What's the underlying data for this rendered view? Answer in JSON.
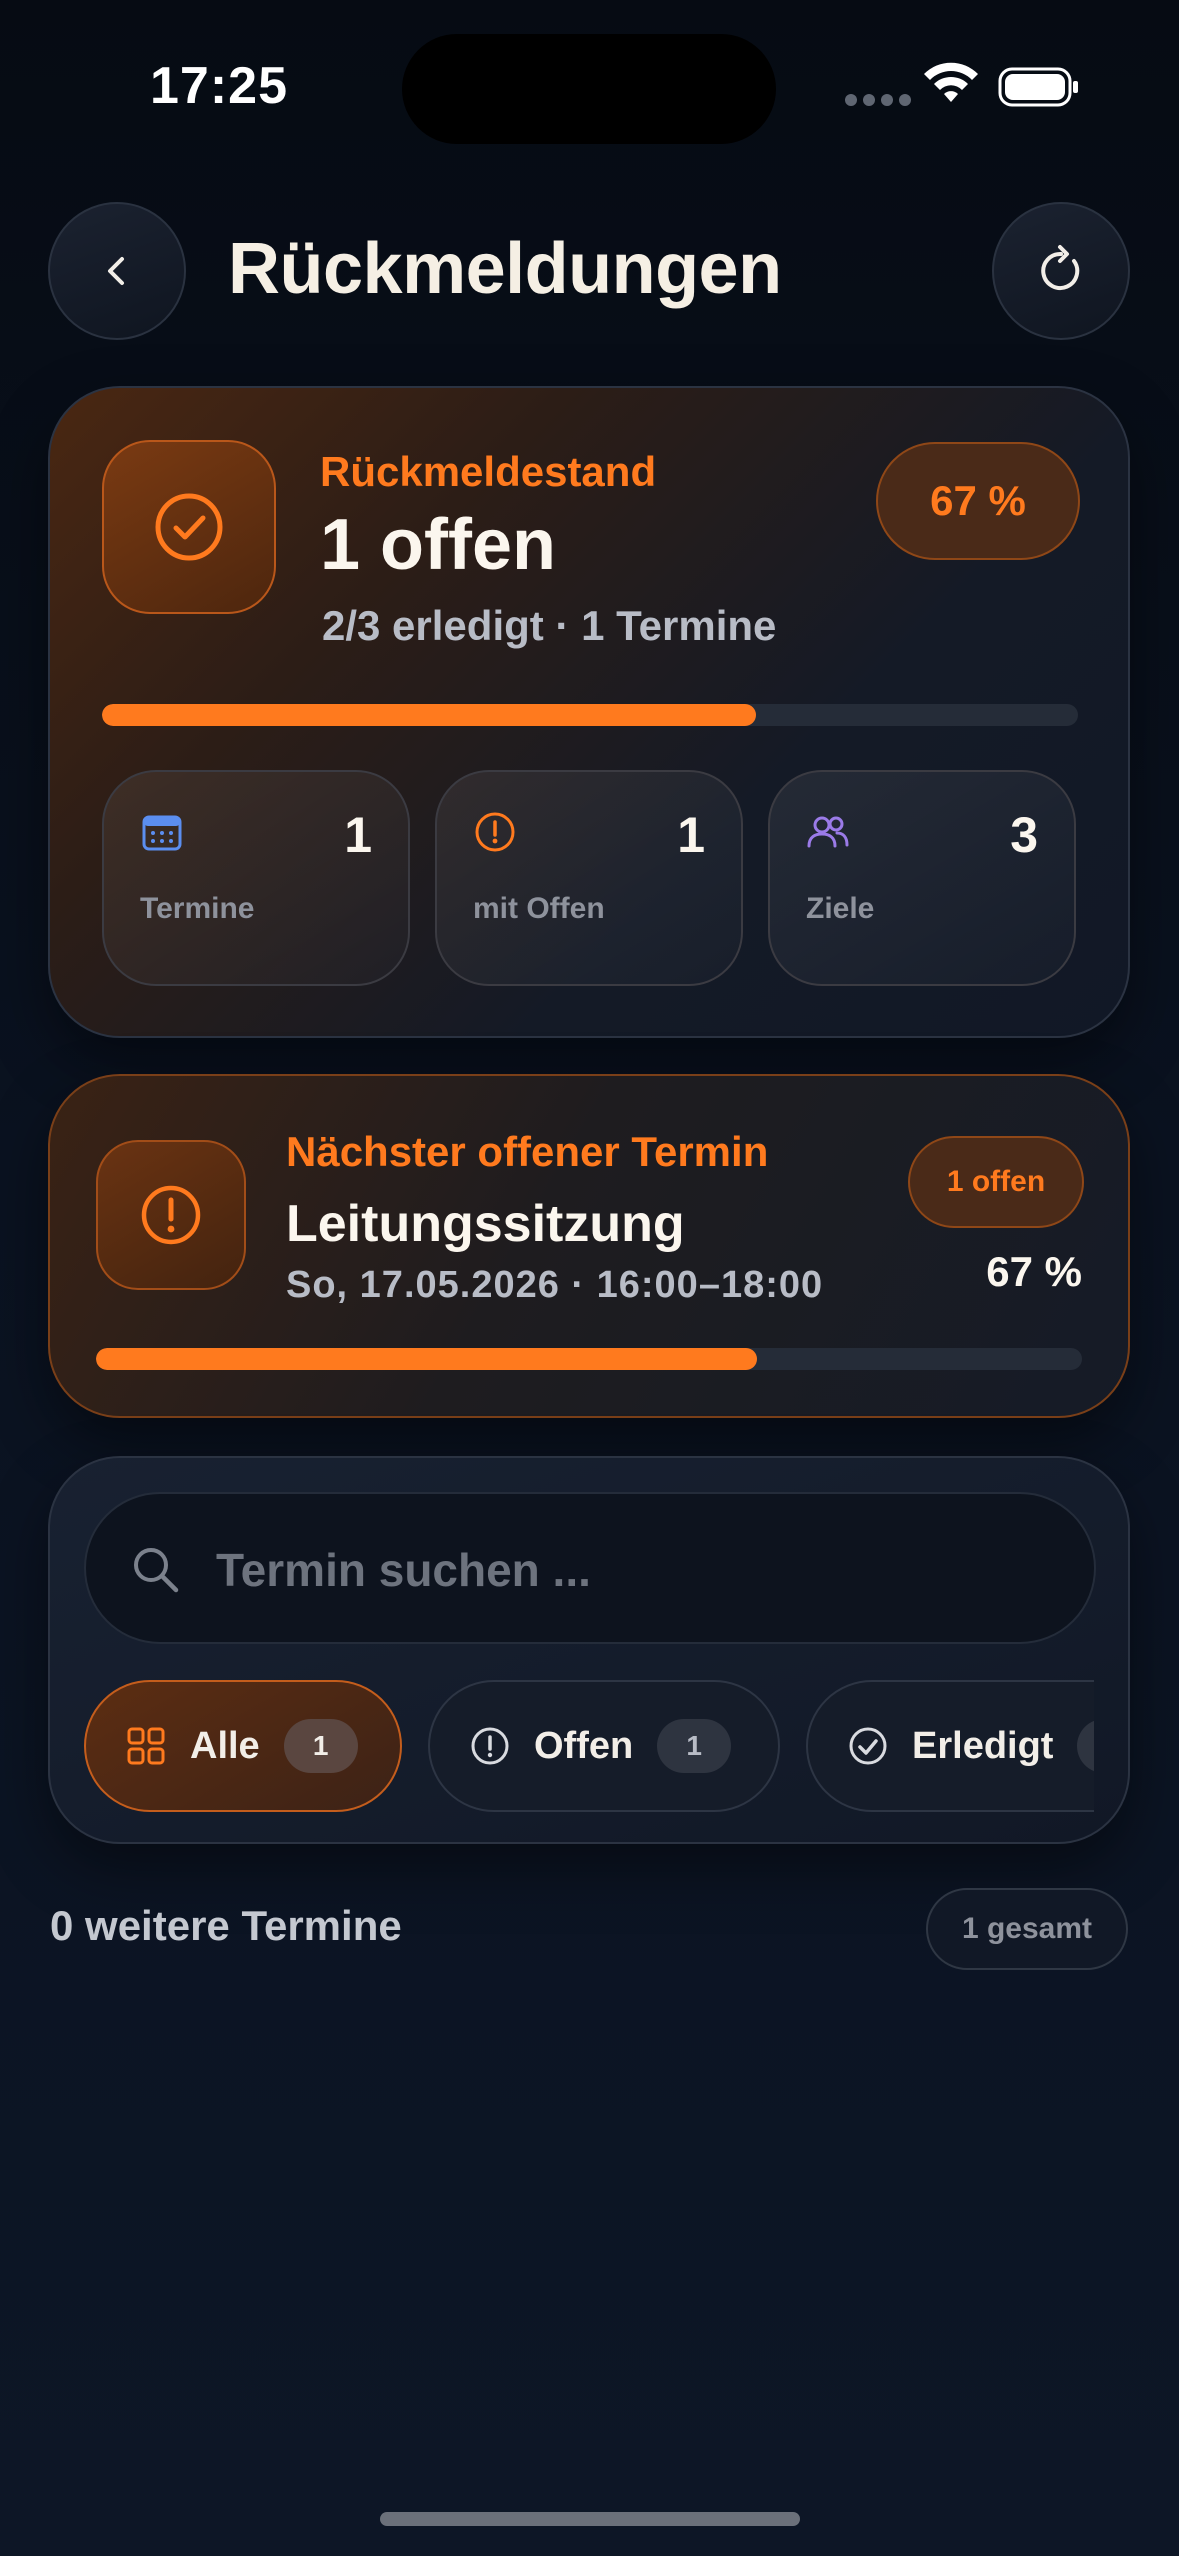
{
  "status_bar": {
    "time": "17:25"
  },
  "header": {
    "title": "Rückmeldungen",
    "back_icon": "chevron-left-icon",
    "refresh_icon": "refresh-icon"
  },
  "summary": {
    "kicker": "Rückmeldestand",
    "title": "1 offen",
    "subtitle": "2/3 erledigt · 1 Termine",
    "percent_label": "67 %",
    "progress": 0.67,
    "stats": [
      {
        "icon": "calendar-icon",
        "value": "1",
        "label": "Termine",
        "color": "#5b8ef0"
      },
      {
        "icon": "alert-circle-icon",
        "value": "1",
        "label": "mit Offen",
        "color": "#ff7a1e"
      },
      {
        "icon": "users-icon",
        "value": "3",
        "label": "Ziele",
        "color": "#9b7be8"
      }
    ]
  },
  "next_appointment": {
    "kicker": "Nächster offener Termin",
    "title": "Leitungssitzung",
    "date": "So, 17.05.2026 · 16:00–18:00",
    "badge": "1 offen",
    "percent_label": "67 %",
    "progress": 0.67
  },
  "filters": {
    "search_placeholder": "Termin suchen ...",
    "search_value": "",
    "chips": [
      {
        "label": "Alle",
        "count": "1",
        "icon": "grid-icon",
        "active": true
      },
      {
        "label": "Offen",
        "count": "1",
        "icon": "alert-circle-icon",
        "active": false
      },
      {
        "label": "Erledigt",
        "count": "",
        "icon": "check-circle-icon",
        "active": false
      }
    ]
  },
  "list": {
    "more_label": "0 weitere Termine",
    "total_badge": "1 gesamt"
  },
  "colors": {
    "accent": "#ff7a1e",
    "background": "#0a1220",
    "track": "#252c38"
  }
}
